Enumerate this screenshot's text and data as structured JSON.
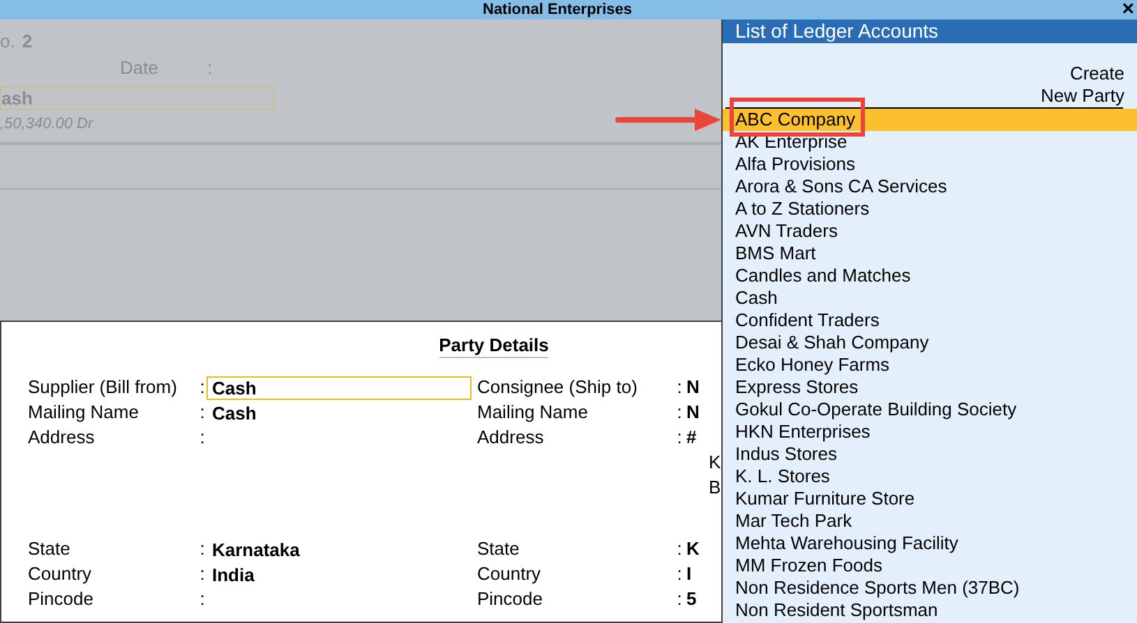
{
  "window": {
    "title": "National Enterprises",
    "close": "×"
  },
  "voucher": {
    "number_label": "o.",
    "number": "2",
    "date_label": "Date",
    "date_colon": ":",
    "account": "ash",
    "balance": ",50,340.00 Dr"
  },
  "party_details": {
    "title": "Party Details",
    "supplier": [
      {
        "label": "Supplier (Bill from)",
        "colon": ":",
        "value": "Cash",
        "focused": true
      },
      {
        "label": "Mailing Name",
        "colon": ":",
        "value": "Cash",
        "focused": false
      },
      {
        "label": "Address",
        "colon": ":",
        "focused": false
      },
      {
        "label": "State",
        "colon": ":",
        "value": "Karnataka",
        "focused": false
      },
      {
        "label": "Country",
        "colon": ":",
        "value": "India",
        "focused": false
      },
      {
        "label": "Pincode",
        "colon": ":",
        "focused": false
      }
    ],
    "consignee": [
      {
        "label": "Consignee (Ship to)",
        "colon": ":",
        "value": "N"
      },
      {
        "label": "Mailing Name",
        "colon": ":",
        "value": "N"
      },
      {
        "label": "Address",
        "colon": ":",
        "value": "#",
        "extra": [
          "K",
          "B"
        ]
      },
      {
        "label": "State",
        "colon": ":",
        "value": "K"
      },
      {
        "label": "Country",
        "colon": ":",
        "value": "I"
      },
      {
        "label": "Pincode",
        "colon": ":",
        "value": "5"
      }
    ]
  },
  "ledger_list": {
    "title": "List of Ledger Accounts",
    "create_lines": [
      "Create",
      "New Party"
    ],
    "items": [
      {
        "name": "ABC Company",
        "selected": true
      },
      {
        "name": "AK Enterprise",
        "selected": false
      },
      {
        "name": "Alfa Provisions",
        "selected": false
      },
      {
        "name": "Arora & Sons CA Services",
        "selected": false
      },
      {
        "name": "A to Z Stationers",
        "selected": false
      },
      {
        "name": "AVN Traders",
        "selected": false
      },
      {
        "name": "BMS Mart",
        "selected": false
      },
      {
        "name": "Candles and Matches",
        "selected": false
      },
      {
        "name": "Cash",
        "selected": false
      },
      {
        "name": "Confident Traders",
        "selected": false
      },
      {
        "name": "Desai & Shah Company",
        "selected": false
      },
      {
        "name": "Ecko Honey Farms",
        "selected": false
      },
      {
        "name": "Express Stores",
        "selected": false
      },
      {
        "name": "Gokul Co-Operate Building Society",
        "selected": false
      },
      {
        "name": "HKN Enterprises",
        "selected": false
      },
      {
        "name": "Indus Stores",
        "selected": false
      },
      {
        "name": "K. L. Stores",
        "selected": false
      },
      {
        "name": "Kumar Furniture Store",
        "selected": false
      },
      {
        "name": "Mar Tech Park",
        "selected": false
      },
      {
        "name": "Mehta Warehousing Facility",
        "selected": false
      },
      {
        "name": "MM Frozen Foods",
        "selected": false
      },
      {
        "name": "Non Residence Sports Men (37BC)",
        "selected": false
      },
      {
        "name": "Non Resident Sportsman",
        "selected": false
      }
    ]
  }
}
